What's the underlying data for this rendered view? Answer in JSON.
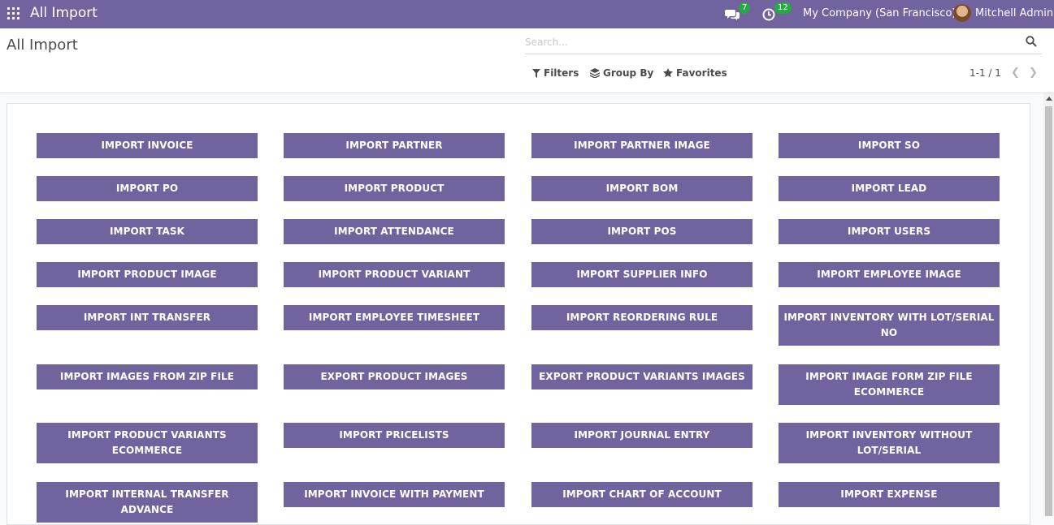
{
  "navbar": {
    "app_title": "All Import",
    "chat_count": "7",
    "activity_count": "12",
    "company": "My Company (San Francisco)",
    "user": "Mitchell Admin"
  },
  "control_panel": {
    "breadcrumb": "All Import",
    "search_placeholder": "Search...",
    "filters_label": "Filters",
    "group_by_label": "Group By",
    "favorites_label": "Favorites",
    "pager": "1-1 / 1"
  },
  "buttons": [
    [
      "IMPORT INVOICE",
      "IMPORT PARTNER",
      "IMPORT PARTNER IMAGE",
      "IMPORT SO"
    ],
    [
      "IMPORT PO",
      "IMPORT PRODUCT",
      "IMPORT BOM",
      "IMPORT LEAD"
    ],
    [
      "IMPORT TASK",
      "IMPORT ATTENDANCE",
      "IMPORT POS",
      "IMPORT USERS"
    ],
    [
      "IMPORT PRODUCT IMAGE",
      "IMPORT PRODUCT VARIANT",
      "IMPORT SUPPLIER INFO",
      "IMPORT EMPLOYEE IMAGE"
    ],
    [
      "IMPORT INT TRANSFER",
      "IMPORT EMPLOYEE TIMESHEET",
      "IMPORT REORDERING RULE",
      "IMPORT INVENTORY WITH LOT/SERIAL NO"
    ],
    [
      "IMPORT IMAGES FROM ZIP FILE",
      "EXPORT PRODUCT IMAGES",
      "EXPORT PRODUCT VARIANTS IMAGES",
      "IMPORT IMAGE FORM ZIP FILE ECOMMERCE"
    ],
    [
      "IMPORT PRODUCT VARIANTS ECOMMERCE",
      "IMPORT PRICELISTS",
      "IMPORT JOURNAL ENTRY",
      "IMPORT INVENTORY WITHOUT LOT/SERIAL"
    ],
    [
      "IMPORT INTERNAL TRANSFER ADVANCE",
      "IMPORT INVOICE WITH PAYMENT",
      "IMPORT CHART OF ACCOUNT",
      "IMPORT EXPENSE"
    ]
  ],
  "colors": {
    "brand": "#71639e",
    "badge": "#28a745"
  }
}
